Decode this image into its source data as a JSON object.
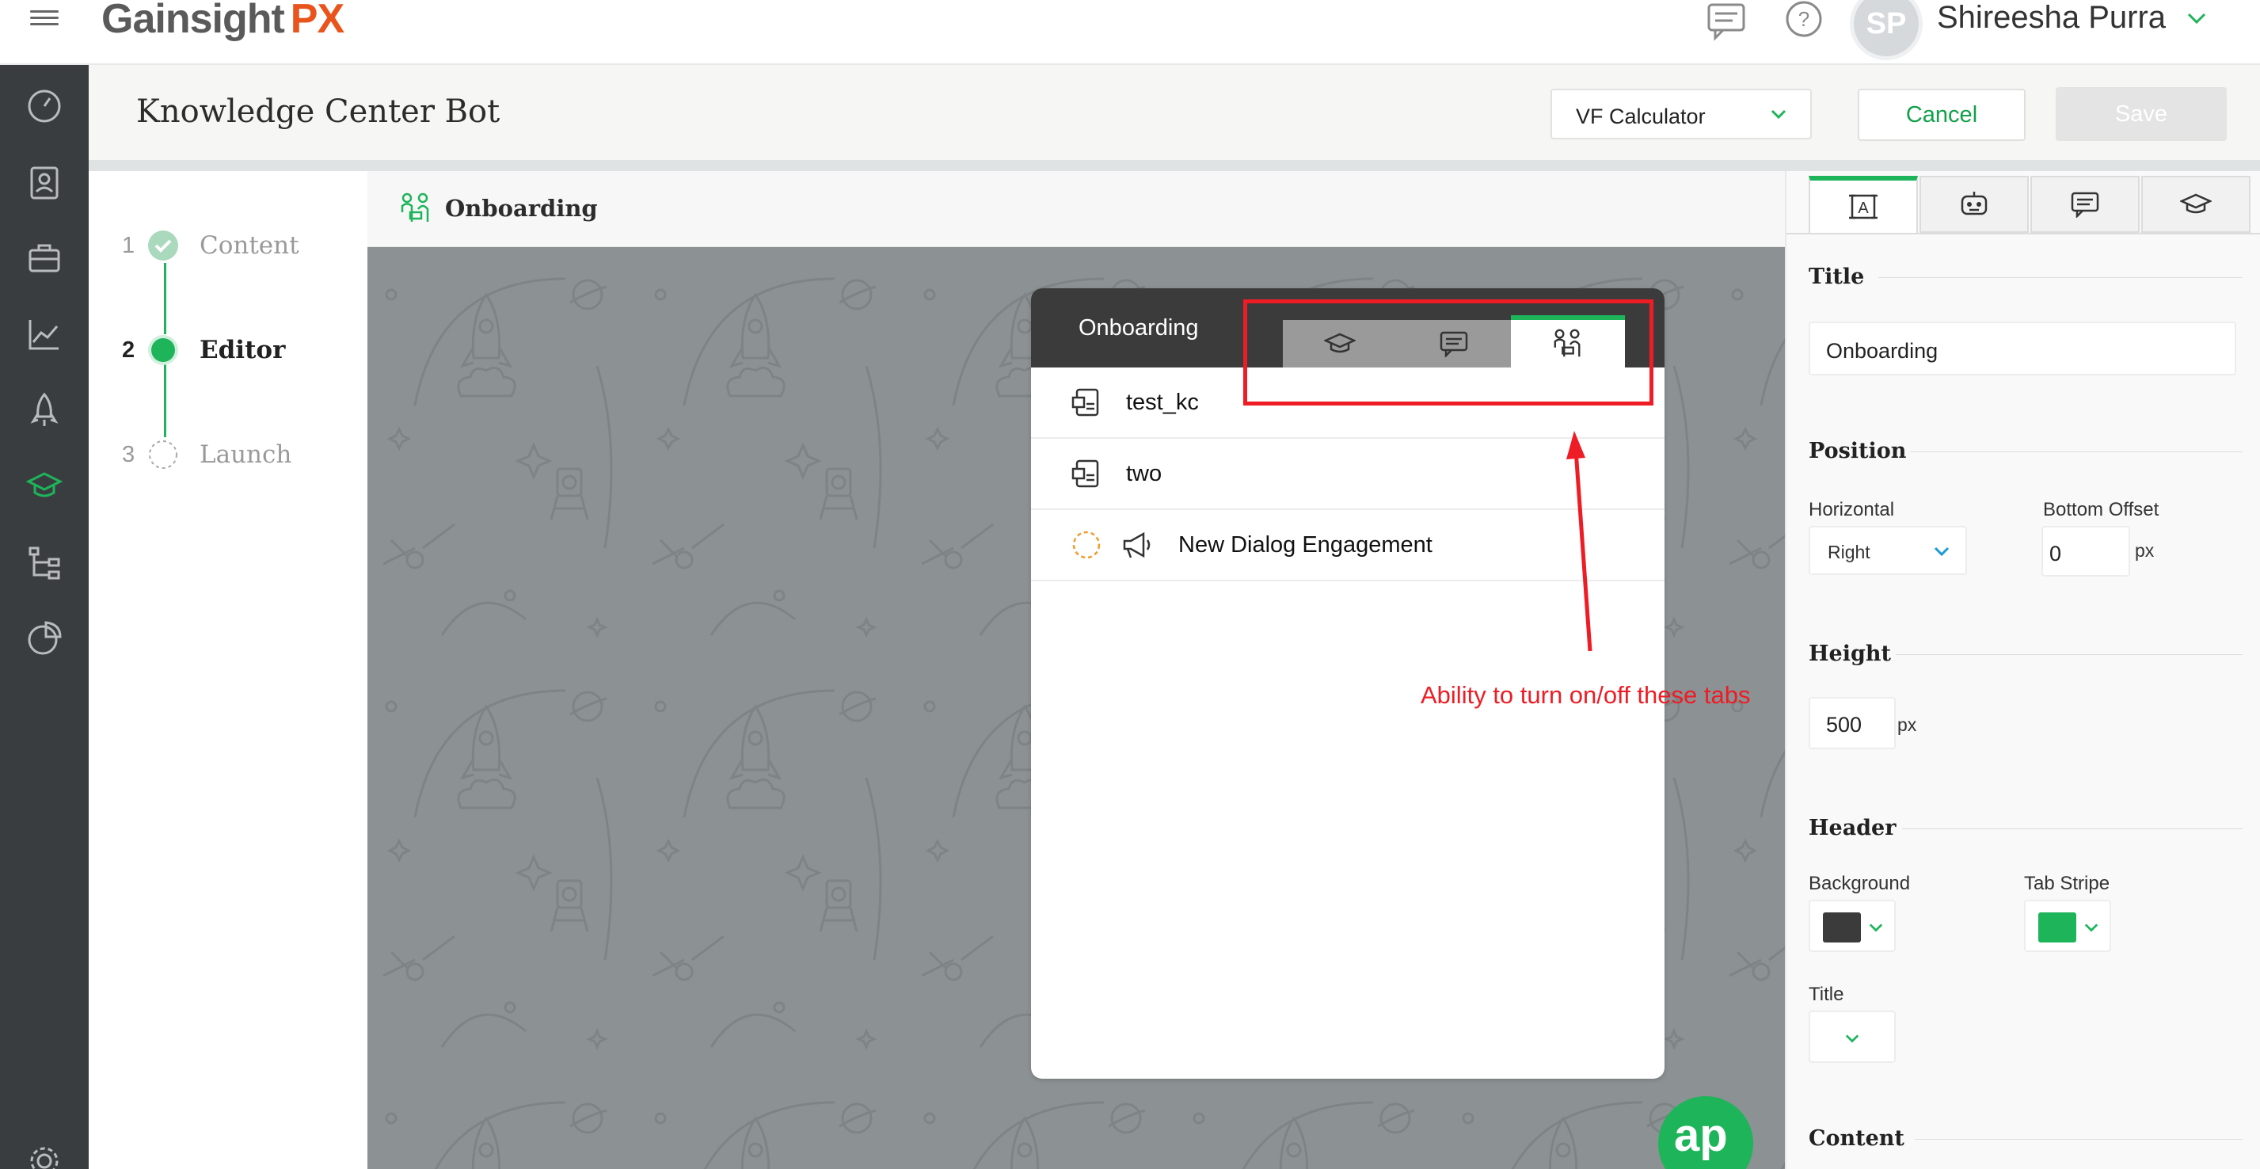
{
  "app": {
    "logo_main": "Gainsight",
    "logo_accent": "PX"
  },
  "user": {
    "initials": "SP",
    "name": "Shireesha Purra"
  },
  "page": {
    "title": "Knowledge Center Bot",
    "selected_product": "VF Calculator",
    "cancel_label": "Cancel",
    "save_label": "Save"
  },
  "stepper": {
    "steps": [
      {
        "num": "1",
        "label": "Content",
        "state": "complete"
      },
      {
        "num": "2",
        "label": "Editor",
        "state": "active"
      },
      {
        "num": "3",
        "label": "Launch",
        "state": "pending"
      }
    ]
  },
  "canvas": {
    "header_title": "Onboarding"
  },
  "widget": {
    "title": "Onboarding",
    "tabs": [
      {
        "icon": "graduation-cap-icon"
      },
      {
        "icon": "chat-bubble-icon"
      },
      {
        "icon": "onboarding-people-icon",
        "active": true
      }
    ],
    "items": [
      {
        "label": "test_kc",
        "icon": "article-icon"
      },
      {
        "label": "two",
        "icon": "article-icon"
      },
      {
        "label": "New Dialog Engagement",
        "icon": "megaphone-icon",
        "status_icon": "dashed-circle-icon"
      }
    ]
  },
  "annotation": {
    "text": "Ability to turn on/off these tabs"
  },
  "bubble": {
    "label": "ap"
  },
  "panel": {
    "tabs": [
      {
        "icon": "text-frame-icon",
        "active": true
      },
      {
        "icon": "bot-icon"
      },
      {
        "icon": "chat-bubble-icon"
      },
      {
        "icon": "graduation-cap-icon"
      }
    ],
    "title_section": {
      "heading": "Title",
      "value": "Onboarding"
    },
    "position_section": {
      "heading": "Position",
      "horizontal_label": "Horizontal",
      "horizontal_value": "Right",
      "bottom_offset_label": "Bottom Offset",
      "bottom_offset_value": "0",
      "unit": "px"
    },
    "height_section": {
      "heading": "Height",
      "value": "500",
      "unit": "px"
    },
    "header_section": {
      "heading": "Header",
      "background_label": "Background",
      "background_color": "#3b3b3b",
      "tab_stripe_label": "Tab Stripe",
      "tab_stripe_color": "#1db45a",
      "title_label": "Title"
    },
    "content_section": {
      "heading": "Content"
    }
  },
  "colors": {
    "accent_green": "#1db45a",
    "annotation_red": "#ee1c24",
    "logo_orange": "#e9531c"
  }
}
